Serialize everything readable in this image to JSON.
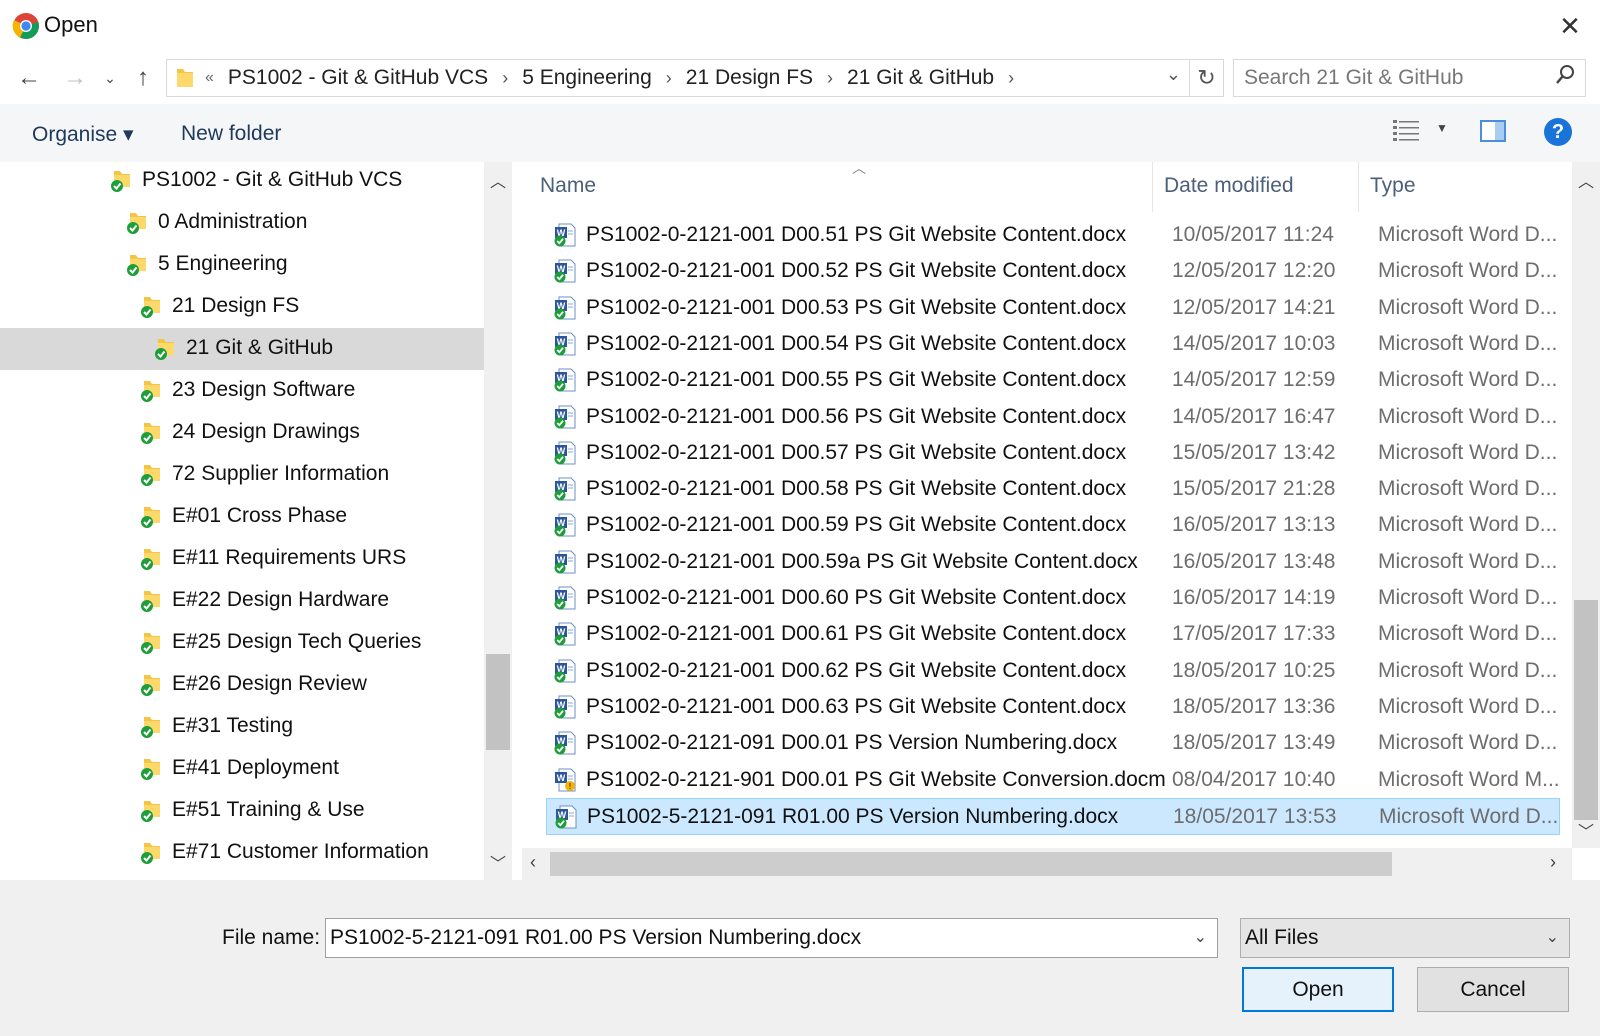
{
  "window": {
    "title": "Open"
  },
  "address": {
    "crumbs": [
      "PS1002 - Git & GitHub VCS",
      "5 Engineering",
      "21 Design FS",
      "21 Git & GitHub"
    ],
    "overflow": "«"
  },
  "search": {
    "placeholder": "Search 21 Git & GitHub"
  },
  "toolbar": {
    "organise": "Organise ▾",
    "new_folder": "New folder",
    "help": "?"
  },
  "tree": [
    {
      "label": "PS1002 - Git & GitHub VCS",
      "selected": false
    },
    {
      "label": "0 Administration",
      "selected": false
    },
    {
      "label": "5 Engineering",
      "selected": false
    },
    {
      "label": "21 Design FS",
      "selected": false
    },
    {
      "label": "21 Git & GitHub",
      "selected": true
    },
    {
      "label": "23 Design Software",
      "selected": false
    },
    {
      "label": "24 Design Drawings",
      "selected": false
    },
    {
      "label": "72 Supplier Information",
      "selected": false
    },
    {
      "label": "E#01 Cross Phase",
      "selected": false
    },
    {
      "label": "E#11 Requirements URS",
      "selected": false
    },
    {
      "label": "E#22 Design Hardware",
      "selected": false
    },
    {
      "label": "E#25 Design Tech Queries",
      "selected": false
    },
    {
      "label": "E#26 Design Review",
      "selected": false
    },
    {
      "label": "E#31 Testing",
      "selected": false
    },
    {
      "label": "E#41 Deployment",
      "selected": false
    },
    {
      "label": "E#51 Training & Use",
      "selected": false
    },
    {
      "label": "E#71 Customer Information",
      "selected": false
    }
  ],
  "columns": {
    "name": "Name",
    "date": "Date modified",
    "type": "Type"
  },
  "files": [
    {
      "name": "PS1002-0-2121-001 D00.51 PS Git Website Content.docx",
      "date": "10/05/2017 11:24",
      "type": "Microsoft Word D...",
      "macro": false
    },
    {
      "name": "PS1002-0-2121-001 D00.52 PS Git Website Content.docx",
      "date": "12/05/2017 12:20",
      "type": "Microsoft Word D...",
      "macro": false
    },
    {
      "name": "PS1002-0-2121-001 D00.53 PS Git Website Content.docx",
      "date": "12/05/2017 14:21",
      "type": "Microsoft Word D...",
      "macro": false
    },
    {
      "name": "PS1002-0-2121-001 D00.54 PS Git Website Content.docx",
      "date": "14/05/2017 10:03",
      "type": "Microsoft Word D...",
      "macro": false
    },
    {
      "name": "PS1002-0-2121-001 D00.55 PS Git Website Content.docx",
      "date": "14/05/2017 12:59",
      "type": "Microsoft Word D...",
      "macro": false
    },
    {
      "name": "PS1002-0-2121-001 D00.56 PS Git Website Content.docx",
      "date": "14/05/2017 16:47",
      "type": "Microsoft Word D...",
      "macro": false
    },
    {
      "name": "PS1002-0-2121-001 D00.57 PS Git Website Content.docx",
      "date": "15/05/2017 13:42",
      "type": "Microsoft Word D...",
      "macro": false
    },
    {
      "name": "PS1002-0-2121-001 D00.58 PS Git Website Content.docx",
      "date": "15/05/2017 21:28",
      "type": "Microsoft Word D...",
      "macro": false
    },
    {
      "name": "PS1002-0-2121-001 D00.59 PS Git Website Content.docx",
      "date": "16/05/2017 13:13",
      "type": "Microsoft Word D...",
      "macro": false
    },
    {
      "name": "PS1002-0-2121-001 D00.59a PS Git Website Content.docx",
      "date": "16/05/2017 13:48",
      "type": "Microsoft Word D...",
      "macro": false
    },
    {
      "name": "PS1002-0-2121-001 D00.60 PS Git Website Content.docx",
      "date": "16/05/2017 14:19",
      "type": "Microsoft Word D...",
      "macro": false
    },
    {
      "name": "PS1002-0-2121-001 D00.61 PS Git Website Content.docx",
      "date": "17/05/2017 17:33",
      "type": "Microsoft Word D...",
      "macro": false
    },
    {
      "name": "PS1002-0-2121-001 D00.62 PS Git Website Content.docx",
      "date": "18/05/2017 10:25",
      "type": "Microsoft Word D...",
      "macro": false
    },
    {
      "name": "PS1002-0-2121-001 D00.63 PS Git Website Content.docx",
      "date": "18/05/2017 13:36",
      "type": "Microsoft Word D...",
      "macro": false
    },
    {
      "name": "PS1002-0-2121-091 D00.01 PS Version Numbering.docx",
      "date": "18/05/2017 13:49",
      "type": "Microsoft Word D...",
      "macro": false
    },
    {
      "name": "PS1002-0-2121-901 D00.01 PS Git Website Conversion.docm",
      "date": "08/04/2017 10:40",
      "type": "Microsoft Word M...",
      "macro": true
    },
    {
      "name": "PS1002-5-2121-091 R01.00 PS Version Numbering.docx",
      "date": "18/05/2017 13:53",
      "type": "Microsoft Word D...",
      "macro": false,
      "selected": true
    }
  ],
  "bottom": {
    "file_name_label": "File name:",
    "file_name_value": "PS1002-5-2121-091 R01.00 PS Version Numbering.docx",
    "filter": "All Files",
    "open_label": "Open",
    "cancel_label": "Cancel"
  },
  "colors": {
    "folder": "#f4c542",
    "sync_green": "#1e9e3a",
    "word_blue": "#2b579a",
    "selection": "#cce8ff",
    "accent": "#0078d7"
  }
}
